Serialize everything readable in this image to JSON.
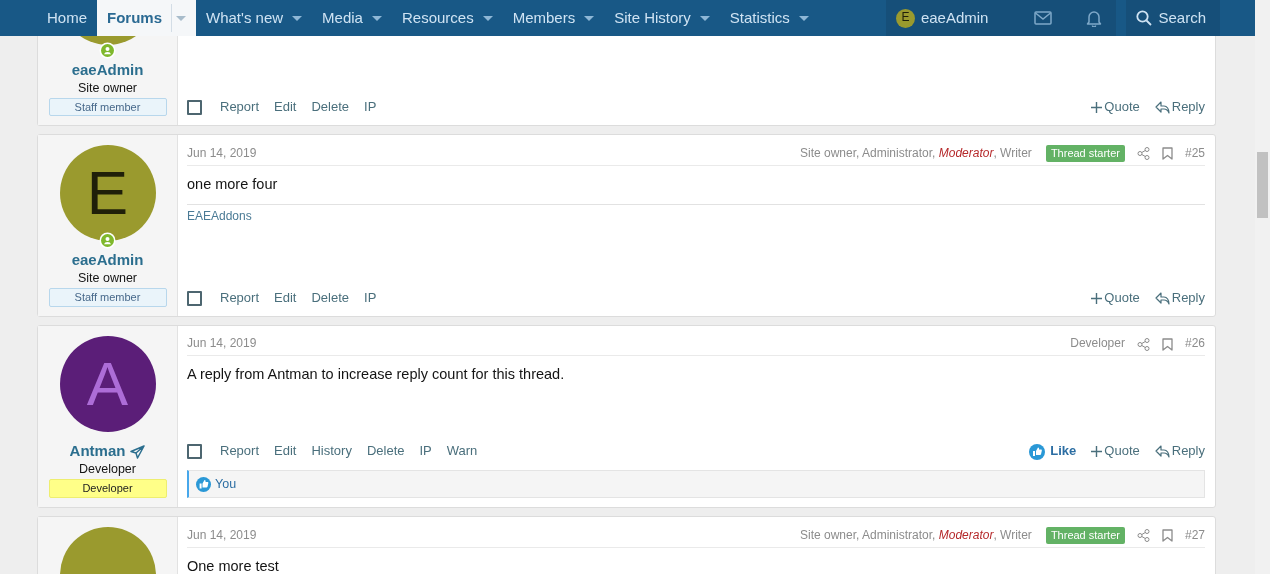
{
  "nav": {
    "items": [
      {
        "label": "Home",
        "selected": false,
        "dropdown": false
      },
      {
        "label": "Forums",
        "selected": true,
        "dropdown": true
      },
      {
        "label": "What's new",
        "selected": false,
        "dropdown": true
      },
      {
        "label": "Media",
        "selected": false,
        "dropdown": true
      },
      {
        "label": "Resources",
        "selected": false,
        "dropdown": true
      },
      {
        "label": "Members",
        "selected": false,
        "dropdown": true
      },
      {
        "label": "Site History",
        "selected": false,
        "dropdown": true
      },
      {
        "label": "Statistics",
        "selected": false,
        "dropdown": true
      }
    ],
    "account": {
      "avatar": {
        "letter": "E",
        "color": "#9a9a2e"
      },
      "name": "eaeAdmin"
    },
    "search": "Search"
  },
  "posts": [
    {
      "selected": false,
      "avatar": {
        "color": "#9a9a2e"
      },
      "online": true,
      "name": "eaeAdmin",
      "name_icon": false,
      "title": "Site owner",
      "banner": {
        "text": "Staff member",
        "kind": "staff"
      },
      "actions": [
        "Report",
        "Edit",
        "Delete",
        "IP"
      ],
      "right_actions": [
        {
          "kind": "quote",
          "label": "Quote"
        },
        {
          "kind": "reply",
          "label": "Reply"
        }
      ]
    },
    {
      "selected": false,
      "avatar": {
        "letter": "E",
        "color": "#9a9a2e"
      },
      "online": true,
      "name": "eaeAdmin",
      "name_icon": false,
      "title": "Site owner",
      "banner": {
        "text": "Staff member",
        "kind": "staff"
      },
      "date": "Jun 14, 2019",
      "user_titles": "Site owner, Administrator, *Moderator*, Writer",
      "thread_starter": "Thread starter",
      "number": "#25",
      "message": "one more four",
      "signature": "EAEAddons",
      "actions": [
        "Report",
        "Edit",
        "Delete",
        "IP"
      ],
      "right_actions": [
        {
          "kind": "quote",
          "label": "Quote"
        },
        {
          "kind": "reply",
          "label": "Reply"
        }
      ]
    },
    {
      "selected": false,
      "avatar": {
        "letter": "A",
        "color": "#5b1e78"
      },
      "online": false,
      "name": "Antman",
      "name_icon": true,
      "title": "Developer",
      "banner": {
        "text": "Developer",
        "kind": "custom"
      },
      "date": "Jun 14, 2019",
      "user_titles": "Developer",
      "number": "#26",
      "message": "A reply from Antman to increase reply count for this thread.",
      "actions": [
        "Report",
        "Edit",
        "History",
        "Delete",
        "IP",
        "Warn"
      ],
      "right_actions": [
        {
          "kind": "like",
          "label": "Like"
        },
        {
          "kind": "quote",
          "label": "Quote"
        },
        {
          "kind": "reply",
          "label": "Reply"
        }
      ],
      "likes": "You"
    },
    {
      "avatar": {
        "color": "#9a9a2e"
      },
      "date": "Jun 14, 2019",
      "user_titles": "Site owner, Administrator, *Moderator*, Writer",
      "thread_starter": "Thread starter",
      "number": "#27",
      "message": "One more test"
    }
  ]
}
